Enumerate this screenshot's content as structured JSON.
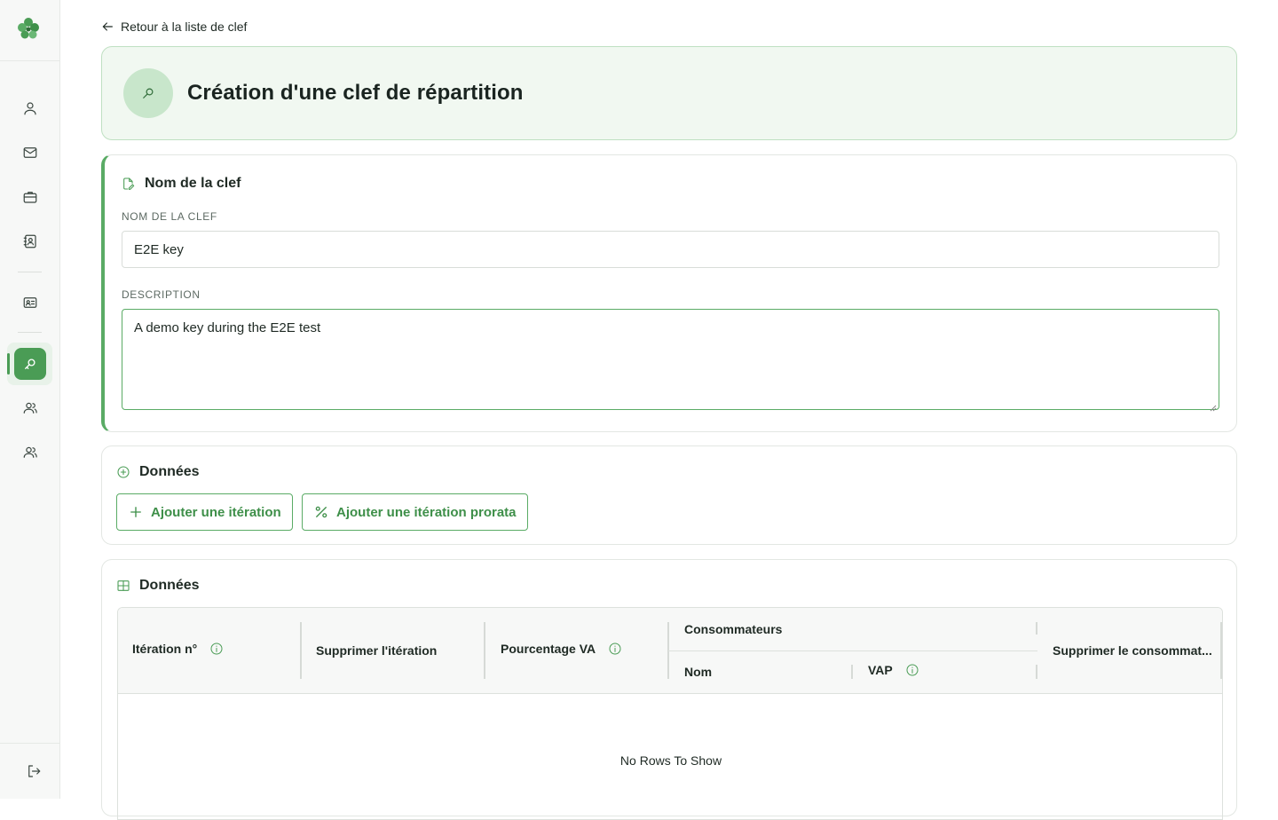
{
  "colors": {
    "accent": "#4a9c55",
    "accent_light": "#c8e6cb",
    "header_bg": "#f1f8f1"
  },
  "sidebar": {
    "logo_icon": "clover-logo-icon",
    "items": [
      {
        "icon": "user-icon"
      },
      {
        "icon": "mail-icon"
      },
      {
        "icon": "briefcase-icon"
      },
      {
        "icon": "contact-book-icon"
      },
      {
        "icon": "id-card-icon"
      },
      {
        "icon": "key-icon",
        "active": true
      },
      {
        "icon": "users-group-icon"
      },
      {
        "icon": "users-group-icon"
      }
    ],
    "logout_icon": "logout-icon"
  },
  "back_link": {
    "label": "Retour à la liste de clef"
  },
  "header": {
    "title": "Création d'une clef de répartition"
  },
  "name_section": {
    "title": "Nom de la clef",
    "name_label": "NOM DE LA CLEF",
    "name_value": "E2E key",
    "description_label": "DESCRIPTION",
    "description_value": "A demo key during the E2E test"
  },
  "data_actions": {
    "title": "Données",
    "add_iteration": "Ajouter une itération",
    "add_prorata_iteration": "Ajouter une itération prorata"
  },
  "data_table": {
    "title": "Données",
    "columns": {
      "iteration": "Itération n°",
      "delete_iteration": "Supprimer l'itération",
      "percentage": "Pourcentage VA",
      "consumers_group": "Consommateurs",
      "name": "Nom",
      "vap": "VAP",
      "delete_consumer": "Supprimer le consommat..."
    },
    "empty_message": "No Rows To Show"
  }
}
